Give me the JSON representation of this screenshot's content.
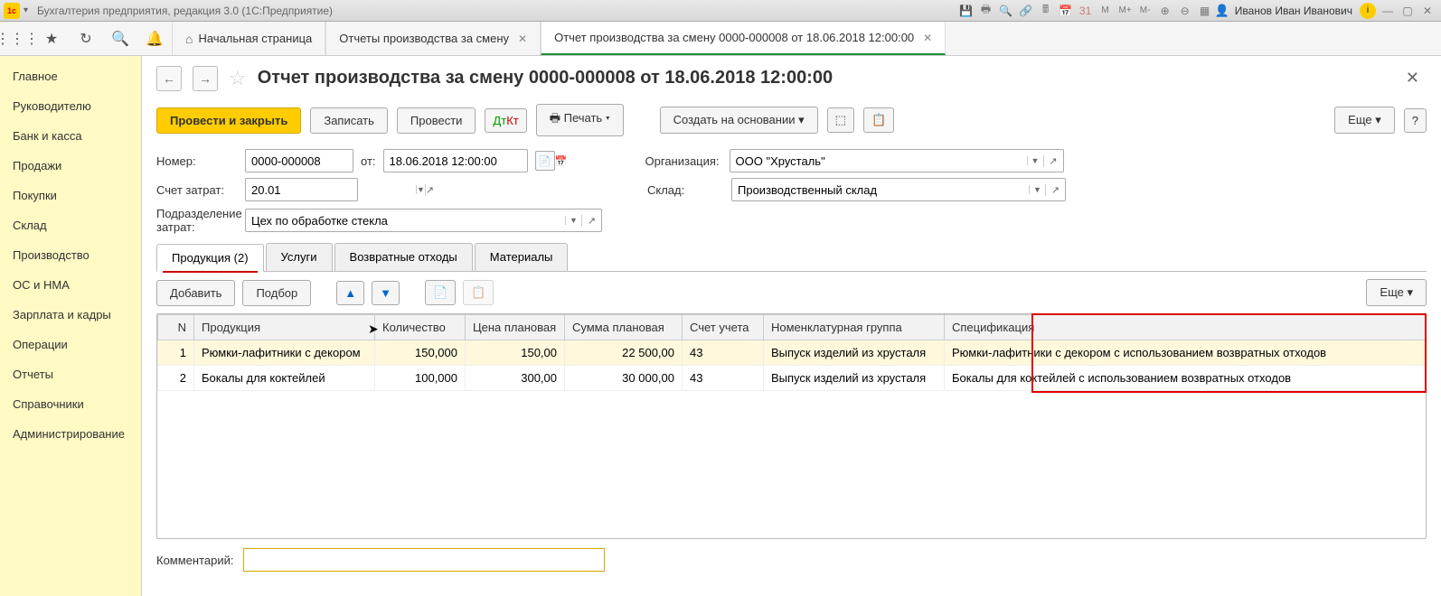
{
  "titlebar": {
    "app_title": "Бухгалтерия предприятия, редакция 3.0 (1С:Предприятие)",
    "user_name": "Иванов Иван Иванович"
  },
  "toolbar_tabs": {
    "home": "Начальная страница",
    "tab1": "Отчеты производства за смену",
    "tab2": "Отчет производства за смену 0000-000008 от 18.06.2018 12:00:00"
  },
  "sidebar": {
    "items": [
      "Главное",
      "Руководителю",
      "Банк и касса",
      "Продажи",
      "Покупки",
      "Склад",
      "Производство",
      "ОС и НМА",
      "Зарплата и кадры",
      "Операции",
      "Отчеты",
      "Справочники",
      "Администрирование"
    ]
  },
  "doc": {
    "title": "Отчет производства за смену 0000-000008 от 18.06.2018 12:00:00"
  },
  "actions": {
    "post_close": "Провести и закрыть",
    "save": "Записать",
    "post": "Провести",
    "print": "Печать",
    "create_based": "Создать на основании",
    "more": "Еще",
    "help": "?"
  },
  "form": {
    "number_label": "Номер:",
    "number_value": "0000-000008",
    "date_label": "от:",
    "date_value": "18.06.2018 12:00:00",
    "org_label": "Организация:",
    "org_value": "ООО \"Хрусталь\"",
    "cost_account_label": "Счет затрат:",
    "cost_account_value": "20.01",
    "warehouse_label": "Склад:",
    "warehouse_value": "Производственный склад",
    "dept_label": "Подразделение затрат:",
    "dept_value": "Цех по обработке стекла"
  },
  "tabs": {
    "products": "Продукция (2)",
    "services": "Услуги",
    "returns": "Возвратные отходы",
    "materials": "Материалы"
  },
  "table_toolbar": {
    "add": "Добавить",
    "pick": "Подбор",
    "more": "Еще"
  },
  "table": {
    "headers": {
      "n": "N",
      "product": "Продукция",
      "qty": "Количество",
      "price": "Цена плановая",
      "sum": "Сумма плановая",
      "account": "Счет учета",
      "nom_group": "Номенклатурная группа",
      "spec": "Спецификация"
    },
    "rows": [
      {
        "n": "1",
        "product": "Рюмки-лафитники с декором",
        "qty": "150,000",
        "price": "150,00",
        "sum": "22 500,00",
        "account": "43",
        "nom_group": "Выпуск изделий из хрусталя",
        "spec": "Рюмки-лафитники с декором с использованием возвратных отходов"
      },
      {
        "n": "2",
        "product": "Бокалы для коктейлей",
        "qty": "100,000",
        "price": "300,00",
        "sum": "30 000,00",
        "account": "43",
        "nom_group": "Выпуск изделий из хрусталя",
        "spec": "Бокалы для коктейлей с использованием возвратных отходов"
      }
    ]
  },
  "comment": {
    "label": "Комментарий:",
    "value": ""
  }
}
